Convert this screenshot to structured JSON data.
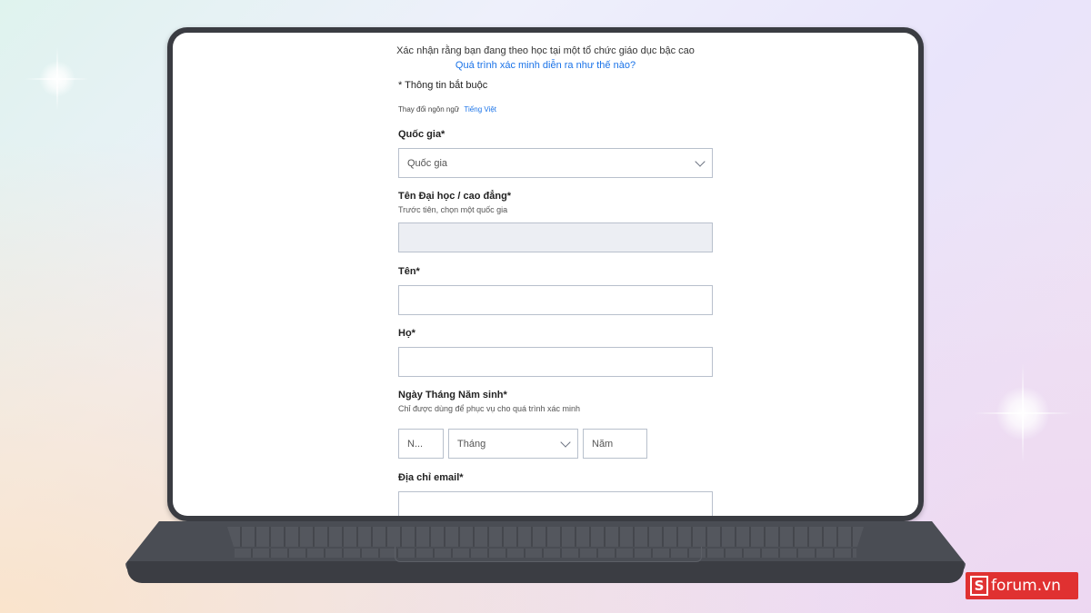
{
  "header": {
    "line1": "Xác nhận rằng bạn đang theo học tại một tổ chức giáo dục bậc cao",
    "link": "Quá trình xác minh diễn ra như thế nào?"
  },
  "form": {
    "required_note": "* Thông tin bắt buộc",
    "language_label": "Thay đổi ngôn ngữ",
    "language_value": "Tiếng Việt",
    "country": {
      "label": "Quốc gia*",
      "placeholder": "Quốc gia"
    },
    "university": {
      "label": "Tên Đại học / cao đẳng*",
      "hint": "Trước tiên, chọn một quốc gia",
      "value": ""
    },
    "first_name": {
      "label": "Tên*",
      "value": ""
    },
    "last_name": {
      "label": "Họ*",
      "value": ""
    },
    "dob": {
      "label": "Ngày Tháng Năm sinh*",
      "hint": "Chỉ được dùng để phục vụ cho quá trình xác minh",
      "day_placeholder": "N...",
      "month_placeholder": "Tháng",
      "year_placeholder": "Năm"
    },
    "email": {
      "label": "Địa chỉ email*",
      "value": ""
    }
  },
  "watermark": {
    "logo": "S",
    "text": "forum.vn"
  },
  "colors": {
    "link": "#1a73e8",
    "bezel": "#3a3c42",
    "watermark": "#e03131"
  }
}
